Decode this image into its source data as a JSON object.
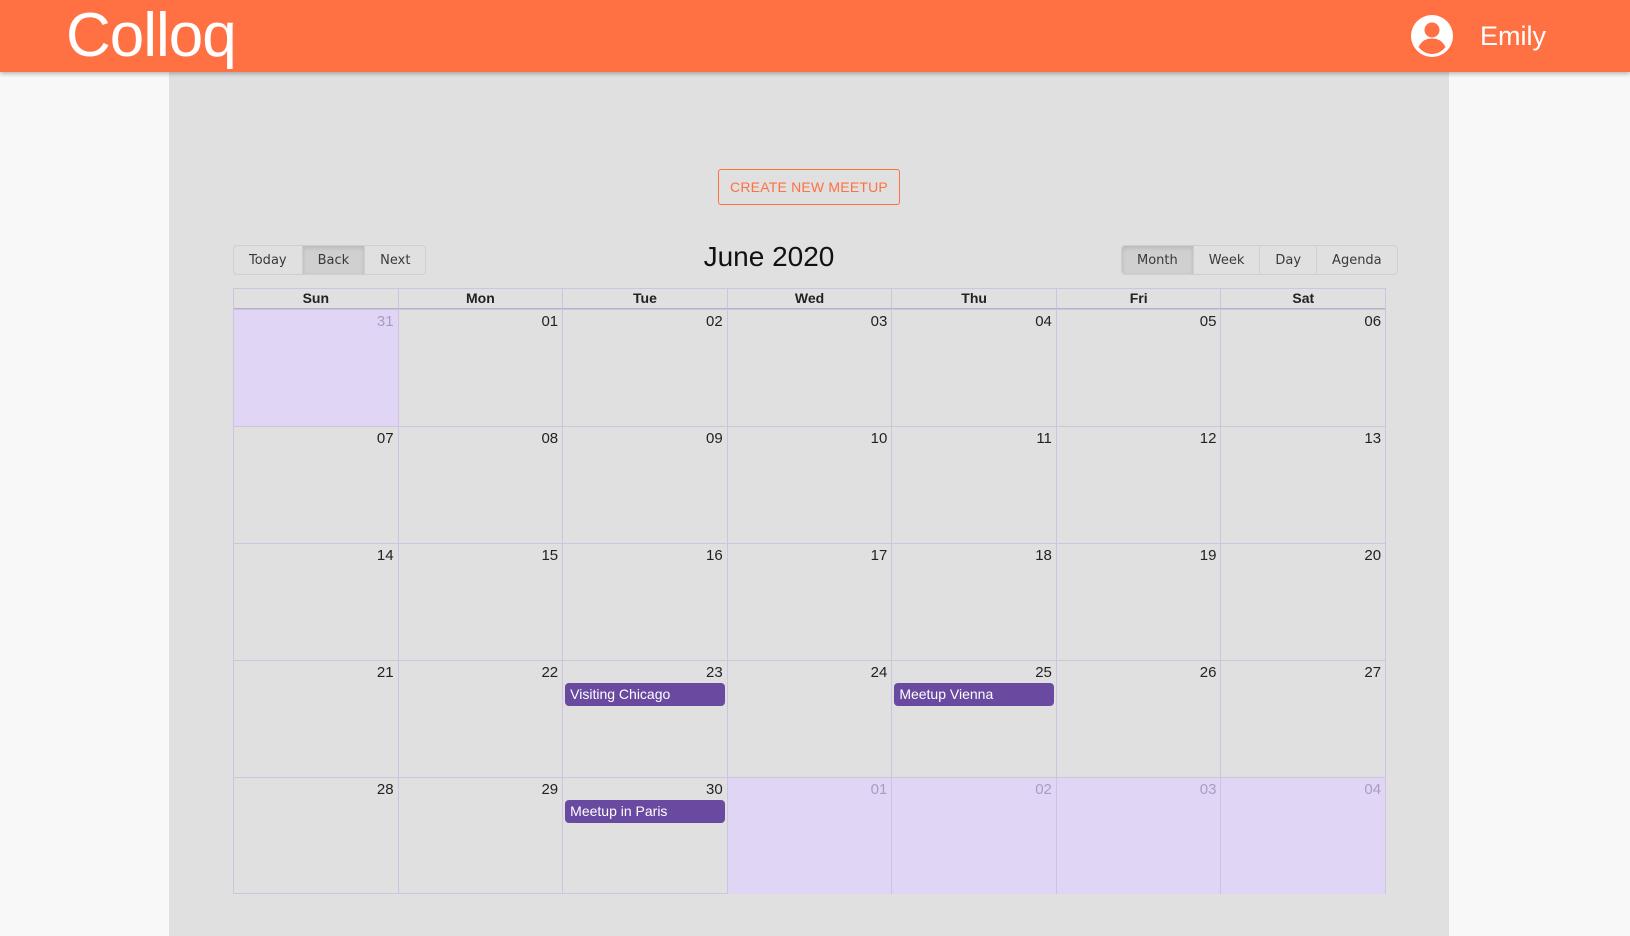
{
  "header": {
    "brand": "Colloq",
    "user_name": "Emily",
    "icon": "account-circle-icon",
    "color": "#ff7043"
  },
  "main": {
    "create_button": "CREATE NEW MEETUP"
  },
  "calendar": {
    "label": "June 2020",
    "nav": {
      "today": "Today",
      "back": "Back",
      "next": "Next"
    },
    "views": {
      "month": "Month",
      "week": "Week",
      "day": "Day",
      "agenda": "Agenda"
    },
    "active_view": "Month",
    "weekdays": [
      "Sun",
      "Mon",
      "Tue",
      "Wed",
      "Thu",
      "Fri",
      "Sat"
    ],
    "weeks": [
      [
        {
          "num": "31",
          "off": true
        },
        {
          "num": "01"
        },
        {
          "num": "02"
        },
        {
          "num": "03"
        },
        {
          "num": "04"
        },
        {
          "num": "05"
        },
        {
          "num": "06"
        }
      ],
      [
        {
          "num": "07"
        },
        {
          "num": "08"
        },
        {
          "num": "09"
        },
        {
          "num": "10"
        },
        {
          "num": "11"
        },
        {
          "num": "12"
        },
        {
          "num": "13"
        }
      ],
      [
        {
          "num": "14"
        },
        {
          "num": "15"
        },
        {
          "num": "16"
        },
        {
          "num": "17"
        },
        {
          "num": "18"
        },
        {
          "num": "19"
        },
        {
          "num": "20"
        }
      ],
      [
        {
          "num": "21"
        },
        {
          "num": "22"
        },
        {
          "num": "23",
          "event": "Visiting Chicago"
        },
        {
          "num": "24"
        },
        {
          "num": "25",
          "event": "Meetup Vienna"
        },
        {
          "num": "26"
        },
        {
          "num": "27"
        }
      ],
      [
        {
          "num": "28"
        },
        {
          "num": "29"
        },
        {
          "num": "30",
          "event": "Meetup in Paris"
        },
        {
          "num": "01",
          "off": true
        },
        {
          "num": "02",
          "off": true
        },
        {
          "num": "03",
          "off": true
        },
        {
          "num": "04",
          "off": true
        }
      ]
    ],
    "colors": {
      "event": "#6a4aa0",
      "off_range": "#e1d5f5"
    }
  }
}
